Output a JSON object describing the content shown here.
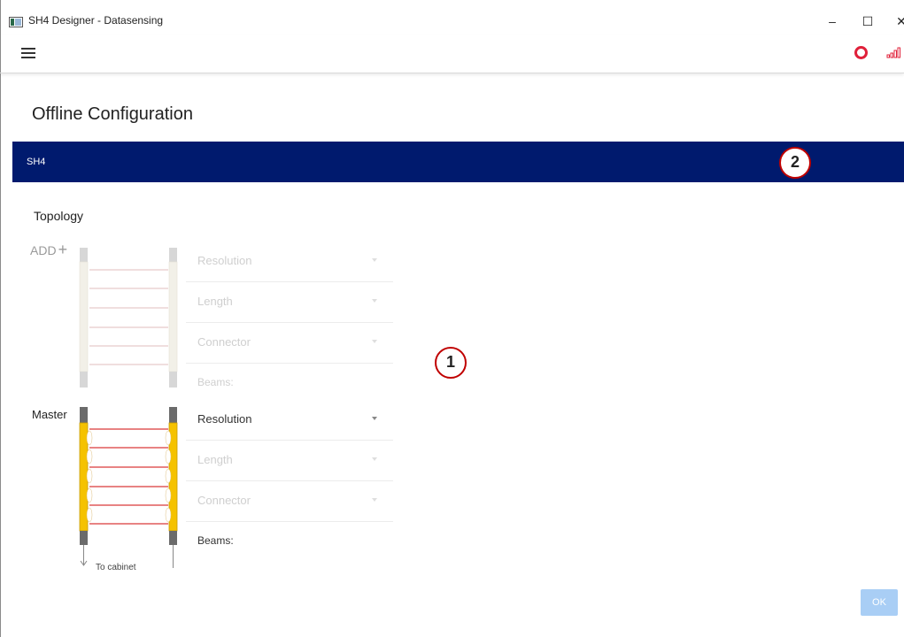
{
  "window": {
    "title": "SH4 Designer - Datasensing",
    "minimize": "–",
    "maximize": "☐",
    "close": "✕"
  },
  "toolbar": {
    "menu_icon": "hamburger-menu-icon",
    "record_icon": "record-stop-icon",
    "signal_icon": "signal-strength-icon",
    "colors": {
      "record": "#e0203a",
      "signal": "#e0203a"
    }
  },
  "page": {
    "title": "Offline Configuration",
    "banner_label": "SH4",
    "banner_color": "#001a6e"
  },
  "topology": {
    "label": "Topology",
    "add_label": "ADD",
    "add_icon": "+",
    "master_label": "Master",
    "cabinet_label": "To cabinet",
    "slave": {
      "resolution": "Resolution",
      "length": "Length",
      "connector": "Connector",
      "beams": "Beams:"
    },
    "master": {
      "resolution": "Resolution",
      "length": "Length",
      "connector": "Connector",
      "beams": "Beams:"
    },
    "colors": {
      "master_housing": "#f5c200",
      "beam": "#e05a5a",
      "slave_housing": "#eeeae0"
    }
  },
  "actions": {
    "ok_label": "OK"
  },
  "callouts": {
    "one": "1",
    "two": "2"
  }
}
